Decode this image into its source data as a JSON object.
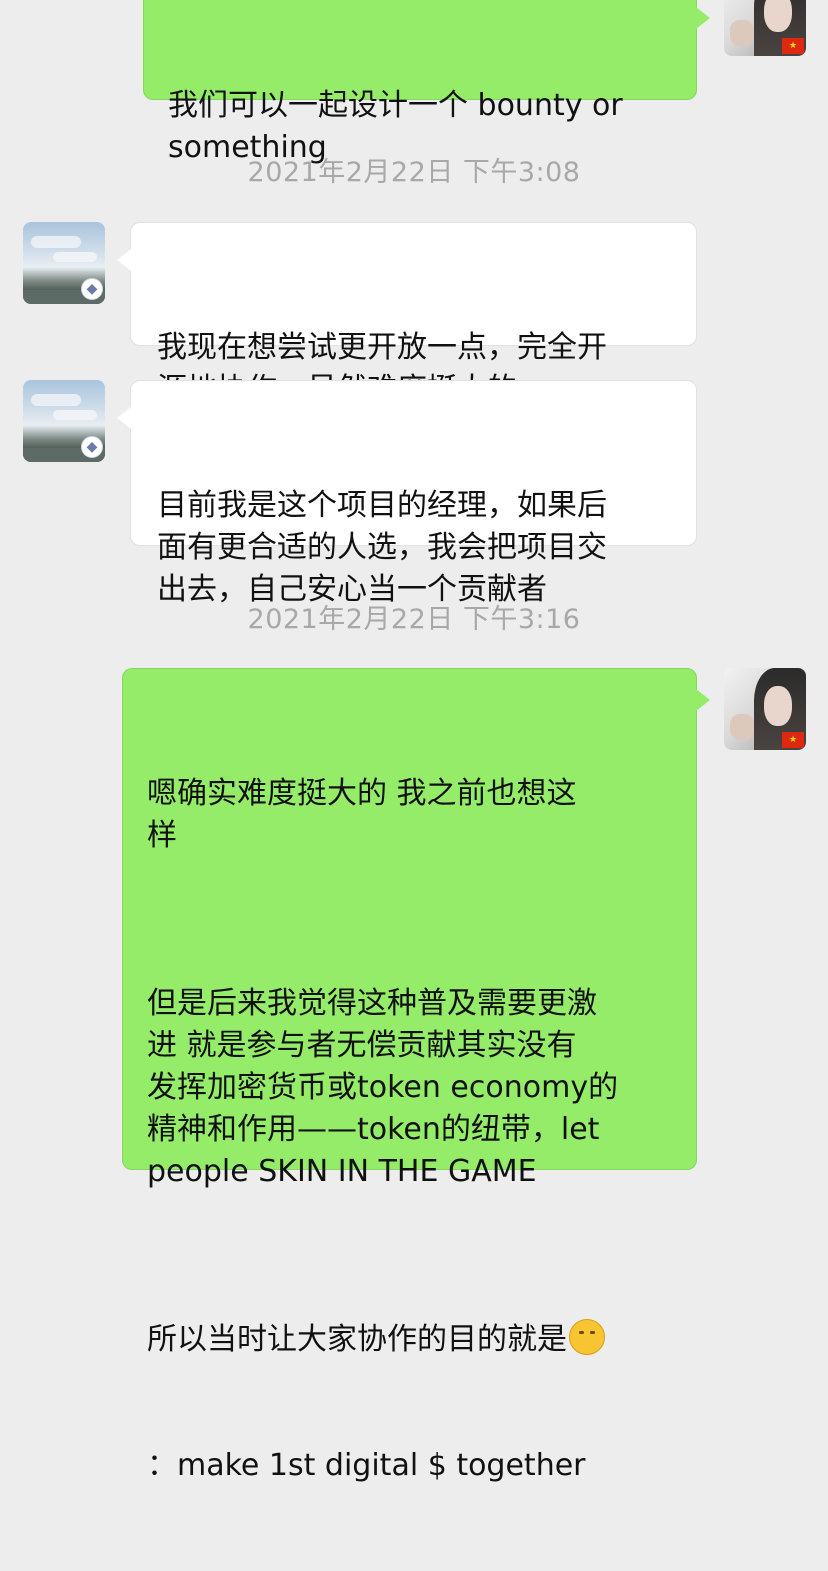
{
  "messages": [
    {
      "side": "out",
      "paragraphs": [
        "我们可以一起设计一个 bounty or\nsomething"
      ]
    },
    {
      "side": "in",
      "paragraphs": [
        "我现在想尝试更开放一点，完全开\n源地协作。虽然难度挺大的"
      ]
    },
    {
      "side": "in",
      "paragraphs": [
        "目前我是这个项目的经理，如果后\n面有更合适的人选，我会把项目交\n出去，自己安心当一个贡献者"
      ]
    },
    {
      "side": "out",
      "paragraphs": [
        "嗯确实难度挺大的 我之前也想这\n样",
        "但是后来我觉得这种普及需要更激\n进 就是参与者无偿贡献其实没有\n发挥加密货币或token economy的\n精神和作用——token的纽带，let\npeople SKIN IN THE GAME",
        "所以当时让大家协作的目的就是",
        "：make 1st digital $ together"
      ]
    }
  ],
  "timestamps": [
    "2021年2月22日 下午3:08",
    "2021年2月22日 下午3:16"
  ],
  "icons": {
    "thinking_emoji": "thinking-face-icon",
    "badge": "ethereum-icon",
    "flag": "china-flag-icon"
  },
  "colors": {
    "background": "#ededed",
    "outgoing_bubble": "#95ec69",
    "incoming_bubble": "#ffffff",
    "timestamp_text": "#a8a8a8"
  }
}
